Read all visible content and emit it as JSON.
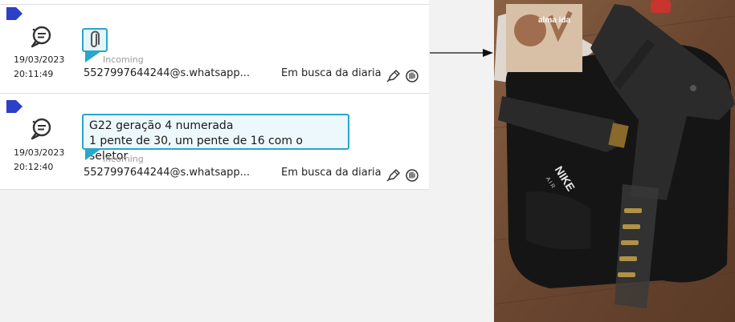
{
  "messages": [
    {
      "date": "19/03/2023",
      "time": "20:11:49",
      "direction": "Incoming",
      "sender": "5527997644244@s.whatsapp...",
      "folder": "Em busca da diaria",
      "content_type": "attachment"
    },
    {
      "date": "19/03/2023",
      "time": "20:12:40",
      "direction": "Incoming",
      "sender": "5527997644244@s.whatsapp...",
      "folder": "Em busca da diaria",
      "text_line1": "G22 geração 4 numerada",
      "text_line2": "1 pente de 30, um pente de 16 com o seletor"
    }
  ],
  "attachment_image": {
    "sticker_text": "alma ida",
    "bag_logo": "NIKE",
    "bag_logo_sub": "A I R"
  },
  "colors": {
    "flag": "#2b3fc7",
    "bubble_border": "#2aa6c8",
    "bubble_fill": "#ecf8fc",
    "incoming_text": "#9a9a9a"
  },
  "icons": [
    "flag-icon",
    "chat-bubble-icon",
    "paperclip-icon",
    "pen-icon",
    "hand-icon",
    "arrow-icon"
  ]
}
